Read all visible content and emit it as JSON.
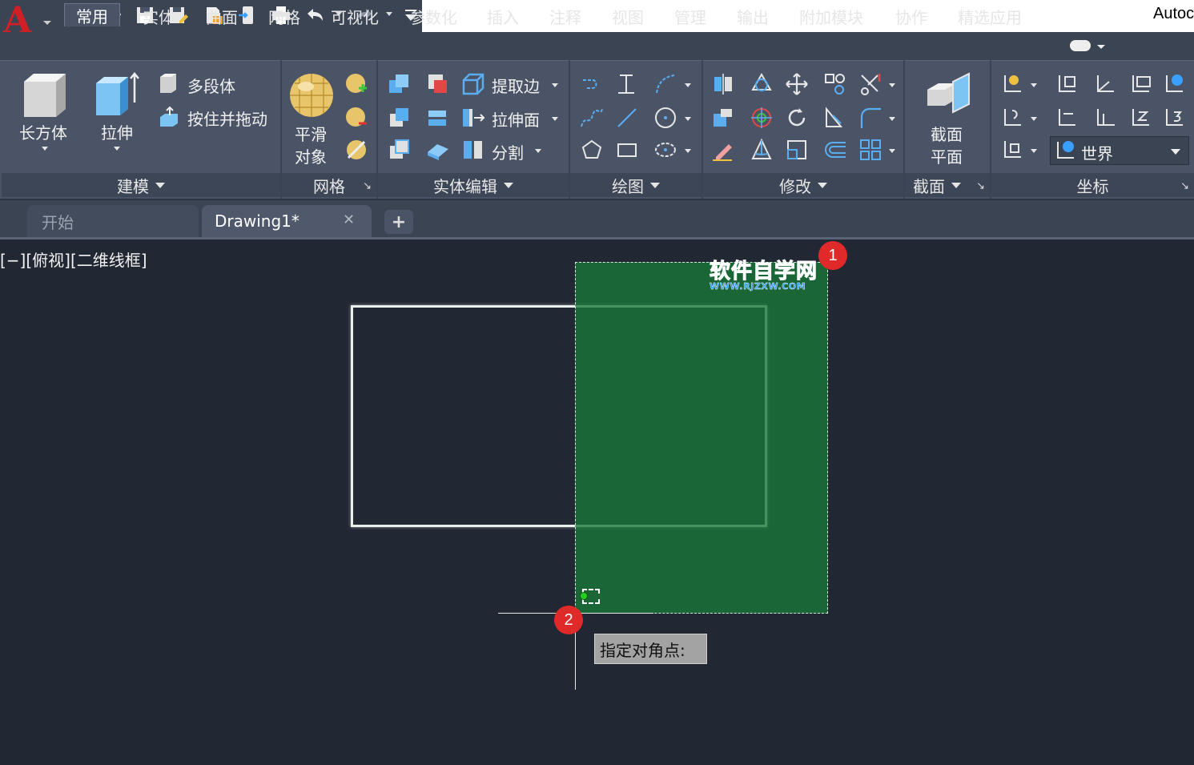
{
  "app": {
    "title": "Autoc",
    "logo_letter": "A"
  },
  "menu": {
    "tabs": [
      "常用",
      "实体",
      "曲面",
      "网格",
      "可视化",
      "参数化",
      "插入",
      "注释",
      "视图",
      "管理",
      "输出",
      "附加模块",
      "协作",
      "精选应用"
    ],
    "active_tab": "常用"
  },
  "ribbon": {
    "modeling": {
      "box": "长方体",
      "extrude": "拉伸",
      "polysolid": "多段体",
      "presspull": "按住并拖动",
      "title": "建模"
    },
    "mesh": {
      "smooth_line1": "平滑",
      "smooth_line2": "对象",
      "title": "网格"
    },
    "solid_editing": {
      "extract_edges": "提取边",
      "extrude_faces": "拉伸面",
      "separate": "分割",
      "title": "实体编辑"
    },
    "draw": {
      "title": "绘图"
    },
    "modify": {
      "title": "修改"
    },
    "section": {
      "plane_line1": "截面",
      "plane_line2": "平面",
      "title": "截面"
    },
    "coordinates": {
      "ucs_select": "世界",
      "title": "坐标"
    }
  },
  "file_tabs": {
    "start": "开始",
    "drawing": "Drawing1*",
    "close": "✕",
    "add": "+"
  },
  "viewport": {
    "label": "[−][俯视][二维线框]",
    "prompt": "指定对角点:",
    "badges": [
      "1",
      "2"
    ],
    "watermark": {
      "main": "软件自学网",
      "url": "WWW.RJZXW.COM"
    }
  },
  "colors": {
    "accent_red": "#d11f26",
    "selection_green": "#1a7838",
    "badge_red": "#e02a2a",
    "canvas": "#222833"
  }
}
